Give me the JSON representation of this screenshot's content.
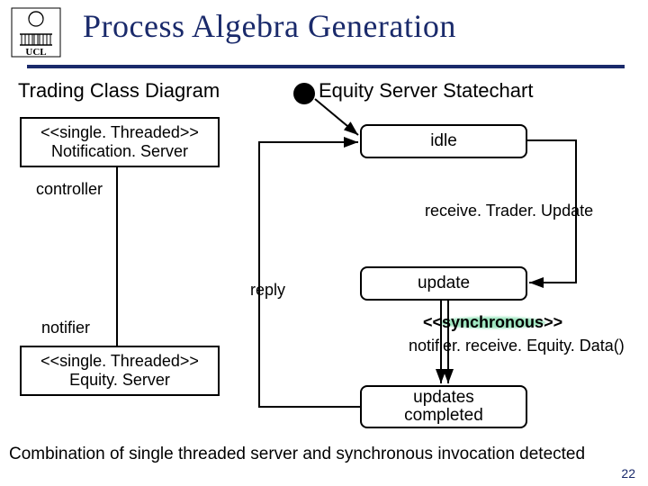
{
  "title": "Process Algebra Generation",
  "left_diagram_title": "Trading Class Diagram",
  "right_diagram_title": "Equity Server Statechart",
  "class_ns": {
    "stereo": "single. Threaded",
    "name": "Notification. Server"
  },
  "class_es": {
    "stereo": "single. Threaded",
    "name": "Equity. Server"
  },
  "assoc": {
    "controller": "controller",
    "notifier": "notifier"
  },
  "states": {
    "idle": "idle",
    "update": "update",
    "updc_l1": "updates",
    "updc_l2": "completed"
  },
  "trans": {
    "rtu": "receive. Trader. Update",
    "reply": "reply",
    "sync_stereo": "synchronous",
    "sync_call": "notifier. receive. Equity. Data()"
  },
  "footer": "Combination of single threaded server and synchronous invocation detected",
  "page": "22",
  "logo_text": "UCL"
}
